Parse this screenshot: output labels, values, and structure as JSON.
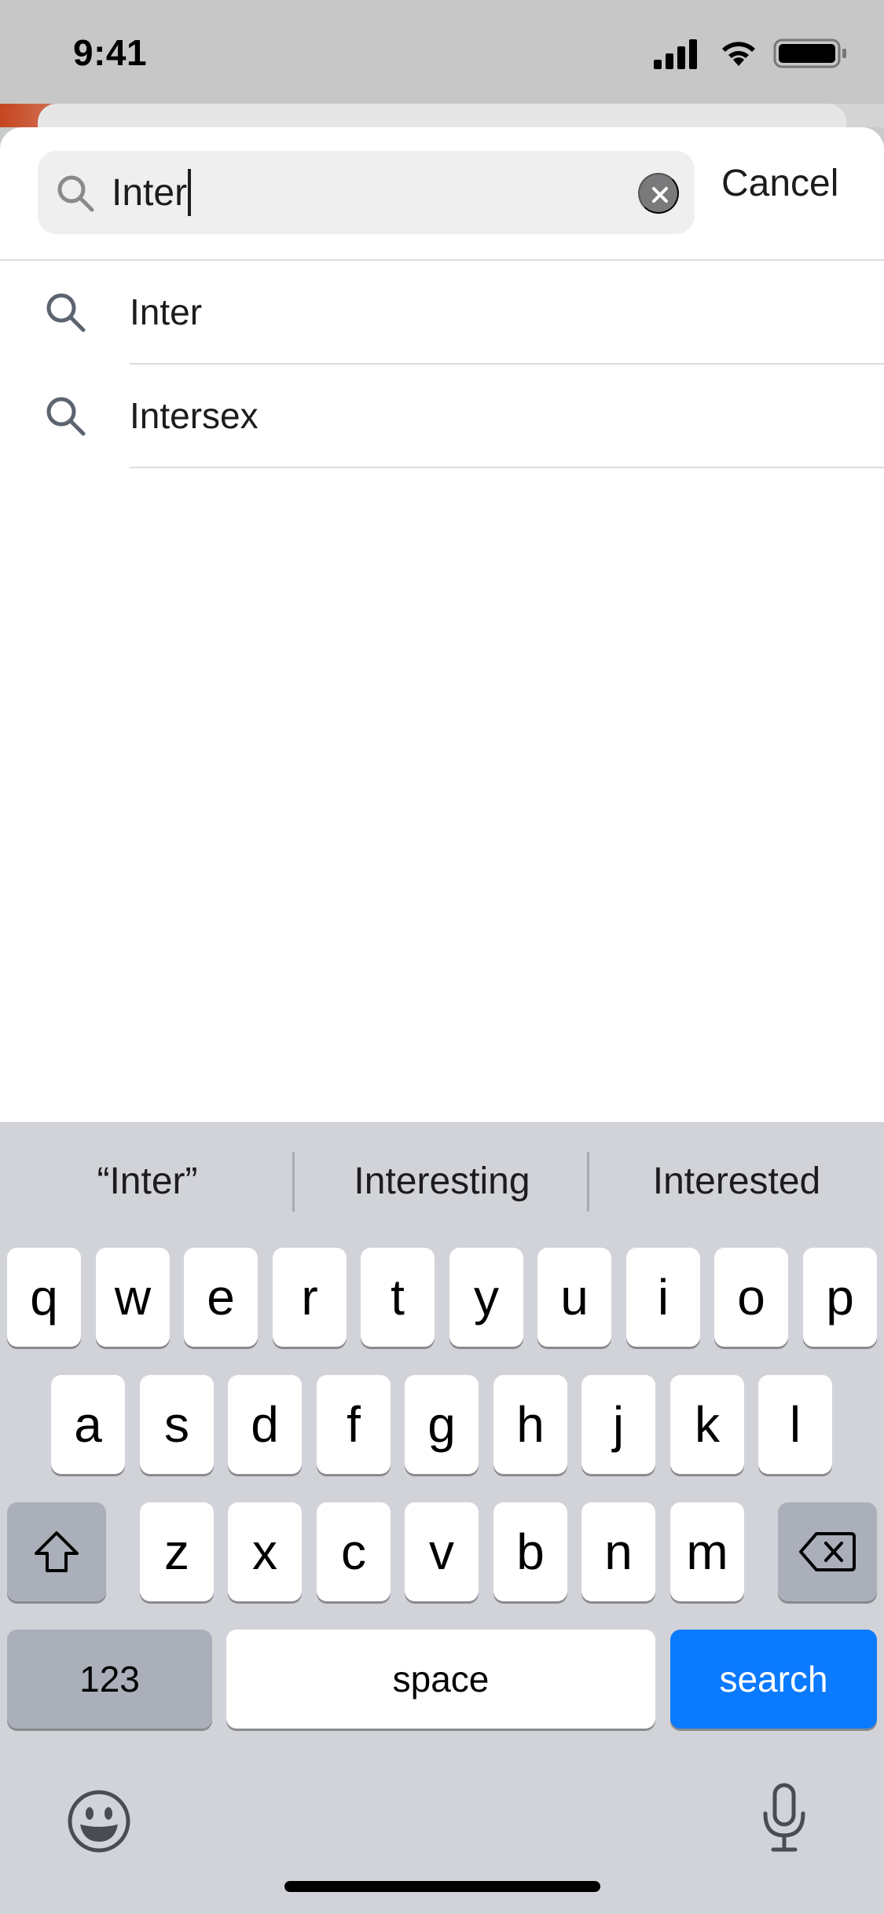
{
  "status_bar": {
    "time": "9:41"
  },
  "search": {
    "value": "Inter",
    "cancel_label": "Cancel"
  },
  "suggestions": [
    {
      "label": "Inter"
    },
    {
      "label": "Intersex"
    }
  ],
  "keyboard": {
    "predictions": [
      "“Inter”",
      "Interesting",
      "Interested"
    ],
    "row1": [
      "q",
      "w",
      "e",
      "r",
      "t",
      "y",
      "u",
      "i",
      "o",
      "p"
    ],
    "row2": [
      "a",
      "s",
      "d",
      "f",
      "g",
      "h",
      "j",
      "k",
      "l"
    ],
    "row3": [
      "z",
      "x",
      "c",
      "v",
      "b",
      "n",
      "m"
    ],
    "numbers_label": "123",
    "space_label": "space",
    "search_label": "search"
  },
  "colors": {
    "accent_blue": "#0a7aff",
    "keyboard_bg": "#d1d3d9",
    "clear_icon_bg": "#7a7a7c"
  },
  "icons": {
    "signal": "cellular-signal-icon",
    "wifi": "wifi-icon",
    "battery": "battery-icon",
    "search": "search-icon",
    "clear": "clear-icon",
    "shift": "shift-icon",
    "delete": "delete-icon",
    "emoji": "emoji-icon",
    "mic": "microphone-icon"
  }
}
